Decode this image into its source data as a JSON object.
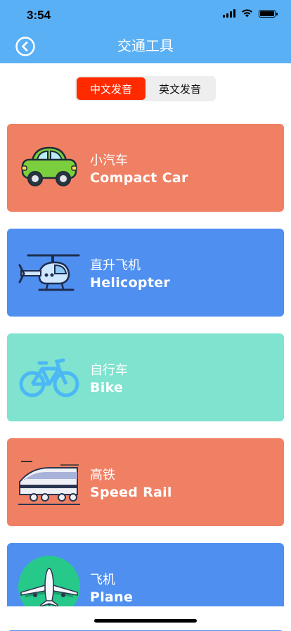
{
  "status": {
    "time": "3:54"
  },
  "header": {
    "title": "交通工具"
  },
  "segment": {
    "options": [
      "中文发音",
      "英文发音"
    ],
    "selected": "中文发音"
  },
  "items": [
    {
      "cn": "小汽车",
      "en": "Compact Car",
      "bg": "#f08064",
      "icon": "car-icon"
    },
    {
      "cn": "直升飞机",
      "en": "Helicopter",
      "bg": "#4f8ff0",
      "icon": "helicopter-icon"
    },
    {
      "cn": "自行车",
      "en": "Bike",
      "bg": "#7fe3d0",
      "icon": "bicycle-icon"
    },
    {
      "cn": "高铁",
      "en": "Speed Rail",
      "bg": "#f08064",
      "icon": "train-icon"
    },
    {
      "cn": "飞机",
      "en": "Plane",
      "bg": "#4f8ff0",
      "icon": "airplane-icon"
    }
  ],
  "colors": {
    "header": "#5ab0f5",
    "segment_active": "#ff2a00"
  }
}
